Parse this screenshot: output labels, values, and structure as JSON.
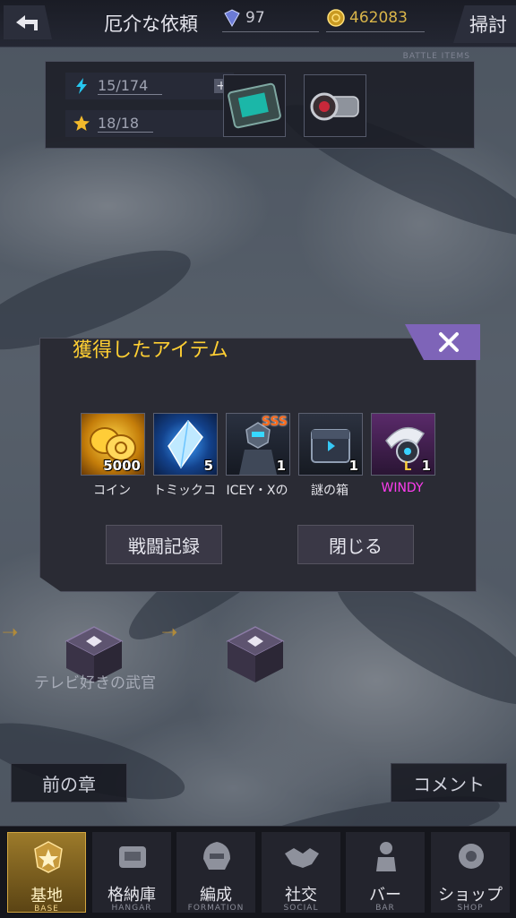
{
  "header": {
    "title": "厄介な依頼",
    "gems": "97",
    "coins": "462083",
    "sweep_label": "掃討"
  },
  "stage_panel": {
    "tag": "BATTLE ITEMS",
    "energy": "15/174",
    "stars": "18/18"
  },
  "map": {
    "node_label": "テレビ好きの武官",
    "prev_chapter": "前の章",
    "comment": "コメント"
  },
  "modal": {
    "title": "獲得したアイテム",
    "items": [
      {
        "label": "コイン",
        "count": "5000"
      },
      {
        "label": "トミックコ",
        "count": "5"
      },
      {
        "label": "ICEY・Xの",
        "count": "1",
        "badge": "SSS"
      },
      {
        "label": "謎の箱",
        "count": "1"
      },
      {
        "label": "WINDY",
        "count": "1",
        "level_prefix": "L"
      }
    ],
    "battle_log": "戦闘記録",
    "close": "閉じる"
  },
  "nav": [
    {
      "jp": "基地",
      "en": "BASE"
    },
    {
      "jp": "格納庫",
      "en": "HANGAR"
    },
    {
      "jp": "編成",
      "en": "FORMATION"
    },
    {
      "jp": "社交",
      "en": "SOCIAL"
    },
    {
      "jp": "バー",
      "en": "BAR"
    },
    {
      "jp": "ショップ",
      "en": "SHOP"
    }
  ],
  "colors": {
    "title_yellow": "#ffcf33",
    "close_purple": "#7e64b8",
    "windy_magenta": "#ff3cf0",
    "active_tab_gold": "#9c7a2a"
  }
}
